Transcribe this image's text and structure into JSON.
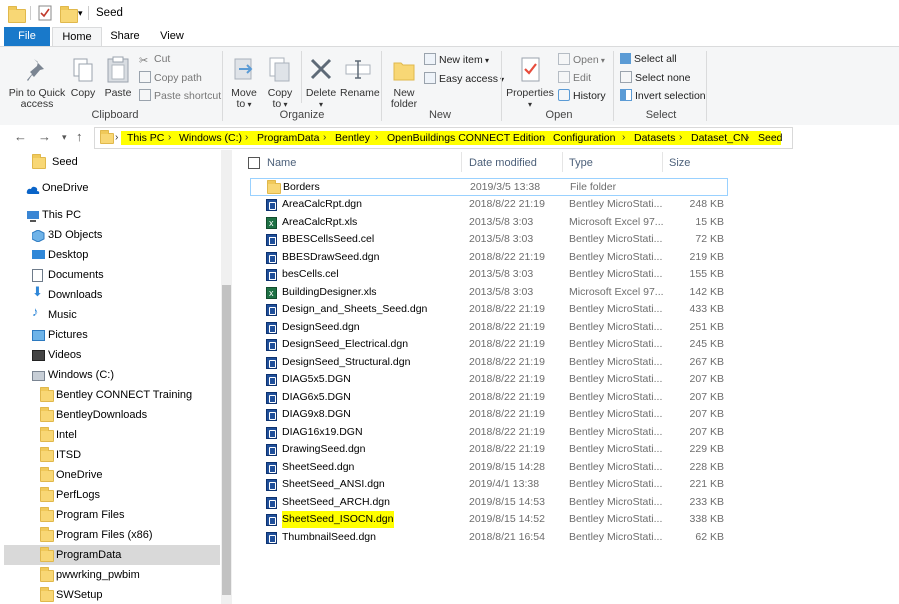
{
  "window": {
    "title": "Seed"
  },
  "tabs": [
    {
      "label": "File"
    },
    {
      "label": "Home"
    },
    {
      "label": "Share"
    },
    {
      "label": "View"
    }
  ],
  "ribbon": {
    "clipboard": {
      "label": "Clipboard",
      "pin": "Pin to Quick access",
      "copy": "Copy",
      "paste": "Paste",
      "cut": "Cut",
      "copy_path": "Copy path",
      "paste_shortcut": "Paste shortcut"
    },
    "organize": {
      "label": "Organize",
      "move_to": "Move to",
      "copy_to": "Copy to",
      "delete": "Delete",
      "rename": "Rename"
    },
    "new": {
      "label": "New",
      "new_folder": "New folder",
      "new_item": "New item",
      "easy_access": "Easy access"
    },
    "open": {
      "label": "Open",
      "properties": "Properties",
      "open": "Open",
      "edit": "Edit",
      "history": "History"
    },
    "select": {
      "label": "Select",
      "select_all": "Select all",
      "select_none": "Select none",
      "invert": "Invert selection"
    }
  },
  "breadcrumbs": [
    "This PC",
    "Windows (C:)",
    "ProgramData",
    "Bentley",
    "OpenBuildings CONNECT Edition",
    "Configuration",
    "Datasets",
    "Dataset_CN",
    "Seed"
  ],
  "nav": {
    "items": [
      {
        "label": "Seed",
        "icon": "folder-icon"
      },
      {
        "label": "OneDrive",
        "icon": "cloud-icon"
      },
      {
        "label": "This PC",
        "icon": "computer-icon"
      },
      {
        "label": "3D Objects",
        "icon": "cube-icon"
      },
      {
        "label": "Desktop",
        "icon": "desktop-icon"
      },
      {
        "label": "Documents",
        "icon": "document-icon"
      },
      {
        "label": "Downloads",
        "icon": "download-icon"
      },
      {
        "label": "Music",
        "icon": "music-icon"
      },
      {
        "label": "Pictures",
        "icon": "picture-icon"
      },
      {
        "label": "Videos",
        "icon": "video-icon"
      },
      {
        "label": "Windows (C:)",
        "icon": "drive-icon"
      },
      {
        "label": "Bentley CONNECT Training",
        "icon": "folder-icon"
      },
      {
        "label": "BentleyDownloads",
        "icon": "folder-icon"
      },
      {
        "label": "Intel",
        "icon": "folder-icon"
      },
      {
        "label": "ITSD",
        "icon": "folder-icon"
      },
      {
        "label": "OneDrive",
        "icon": "folder-icon"
      },
      {
        "label": "PerfLogs",
        "icon": "folder-icon"
      },
      {
        "label": "Program Files",
        "icon": "folder-icon"
      },
      {
        "label": "Program Files (x86)",
        "icon": "folder-icon"
      },
      {
        "label": "ProgramData",
        "icon": "folder-icon"
      },
      {
        "label": "pwwrking_pwbim",
        "icon": "folder-icon"
      },
      {
        "label": "SWSetup",
        "icon": "folder-icon"
      }
    ]
  },
  "columns": {
    "name": "Name",
    "date": "Date modified",
    "type": "Type",
    "size": "Size"
  },
  "files": [
    {
      "name": "Borders",
      "date": "2019/3/5 13:38",
      "type": "File folder",
      "size": "",
      "icon": "folder-icon"
    },
    {
      "name": "AreaCalcRpt.dgn",
      "date": "2018/8/22 21:19",
      "type": "Bentley MicroStati...",
      "size": "248 KB",
      "icon": "dgn-file-icon"
    },
    {
      "name": "AreaCalcRpt.xls",
      "date": "2013/5/8 3:03",
      "type": "Microsoft Excel 97...",
      "size": "15 KB",
      "icon": "excel-file-icon"
    },
    {
      "name": "BBESCellsSeed.cel",
      "date": "2013/5/8 3:03",
      "type": "Bentley MicroStati...",
      "size": "72 KB",
      "icon": "cel-file-icon"
    },
    {
      "name": "BBESDrawSeed.dgn",
      "date": "2018/8/22 21:19",
      "type": "Bentley MicroStati...",
      "size": "219 KB",
      "icon": "dgn-file-icon"
    },
    {
      "name": "besCells.cel",
      "date": "2013/5/8 3:03",
      "type": "Bentley MicroStati...",
      "size": "155 KB",
      "icon": "cel-file-icon"
    },
    {
      "name": "BuildingDesigner.xls",
      "date": "2013/5/8 3:03",
      "type": "Microsoft Excel 97...",
      "size": "142 KB",
      "icon": "excel-file-icon"
    },
    {
      "name": "Design_and_Sheets_Seed.dgn",
      "date": "2018/8/22 21:19",
      "type": "Bentley MicroStati...",
      "size": "433 KB",
      "icon": "dgn-file-icon"
    },
    {
      "name": "DesignSeed.dgn",
      "date": "2018/8/22 21:19",
      "type": "Bentley MicroStati...",
      "size": "251 KB",
      "icon": "dgn-file-icon"
    },
    {
      "name": "DesignSeed_Electrical.dgn",
      "date": "2018/8/22 21:19",
      "type": "Bentley MicroStati...",
      "size": "245 KB",
      "icon": "dgn-file-icon"
    },
    {
      "name": "DesignSeed_Structural.dgn",
      "date": "2018/8/22 21:19",
      "type": "Bentley MicroStati...",
      "size": "267 KB",
      "icon": "dgn-file-icon"
    },
    {
      "name": "DIAG5x5.DGN",
      "date": "2018/8/22 21:19",
      "type": "Bentley MicroStati...",
      "size": "207 KB",
      "icon": "dgn-file-icon"
    },
    {
      "name": "DIAG6x5.DGN",
      "date": "2018/8/22 21:19",
      "type": "Bentley MicroStati...",
      "size": "207 KB",
      "icon": "dgn-file-icon"
    },
    {
      "name": "DIAG9x8.DGN",
      "date": "2018/8/22 21:19",
      "type": "Bentley MicroStati...",
      "size": "207 KB",
      "icon": "dgn-file-icon"
    },
    {
      "name": "DIAG16x19.DGN",
      "date": "2018/8/22 21:19",
      "type": "Bentley MicroStati...",
      "size": "207 KB",
      "icon": "dgn-file-icon"
    },
    {
      "name": "DrawingSeed.dgn",
      "date": "2018/8/22 21:19",
      "type": "Bentley MicroStati...",
      "size": "229 KB",
      "icon": "dgn-file-icon"
    },
    {
      "name": "SheetSeed.dgn",
      "date": "2019/8/15 14:28",
      "type": "Bentley MicroStati...",
      "size": "228 KB",
      "icon": "dgn-file-icon"
    },
    {
      "name": "SheetSeed_ANSI.dgn",
      "date": "2019/4/1 13:38",
      "type": "Bentley MicroStati...",
      "size": "221 KB",
      "icon": "dgn-file-icon"
    },
    {
      "name": "SheetSeed_ARCH.dgn",
      "date": "2019/8/15 14:53",
      "type": "Bentley MicroStati...",
      "size": "233 KB",
      "icon": "dgn-file-icon"
    },
    {
      "name": "SheetSeed_ISOCN.dgn",
      "date": "2019/8/15 14:52",
      "type": "Bentley MicroStati...",
      "size": "338 KB",
      "icon": "dgn-file-icon"
    },
    {
      "name": "ThumbnailSeed.dgn",
      "date": "2018/8/21 16:54",
      "type": "Bentley MicroStati...",
      "size": "62 KB",
      "icon": "dgn-file-icon"
    }
  ],
  "colors": {
    "accent": "#1979ca",
    "highlight": "#ffff00",
    "selection": "#cce8ff"
  }
}
